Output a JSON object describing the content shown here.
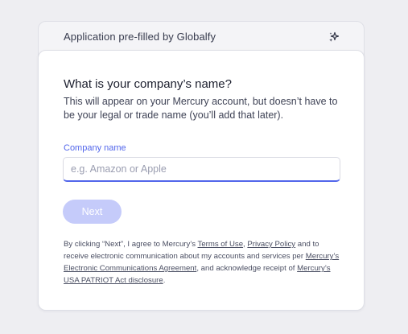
{
  "banner": {
    "text": "Application pre-filled by Globalfy",
    "icon": "sparkle-icon"
  },
  "form": {
    "heading": "What is your company’s name?",
    "description": "This will appear on your Mercury account, but doesn’t have to be your legal or trade name (you’ll add that later).",
    "field_label": "Company name",
    "input_value": "",
    "input_placeholder": "e.g. Amazon or Apple",
    "next_label": "Next",
    "next_enabled": false
  },
  "legal": {
    "part1": "By clicking “Next”, I agree to Mercury’s ",
    "link_terms": "Terms of Use",
    "part2": ", ",
    "link_privacy": "Privacy Policy",
    "part3": " and to receive electronic communication about my accounts and services per ",
    "link_esign": "Mercury’s Electronic Communications Agreement",
    "part4": ", and acknowledge receipt of ",
    "link_patriot": "Mercury’s USA PATRIOT Act disclosure",
    "part5": "."
  },
  "colors": {
    "accent": "#5266eb",
    "button_disabled": "#c5cbfa",
    "page_background": "#eeeef2"
  }
}
